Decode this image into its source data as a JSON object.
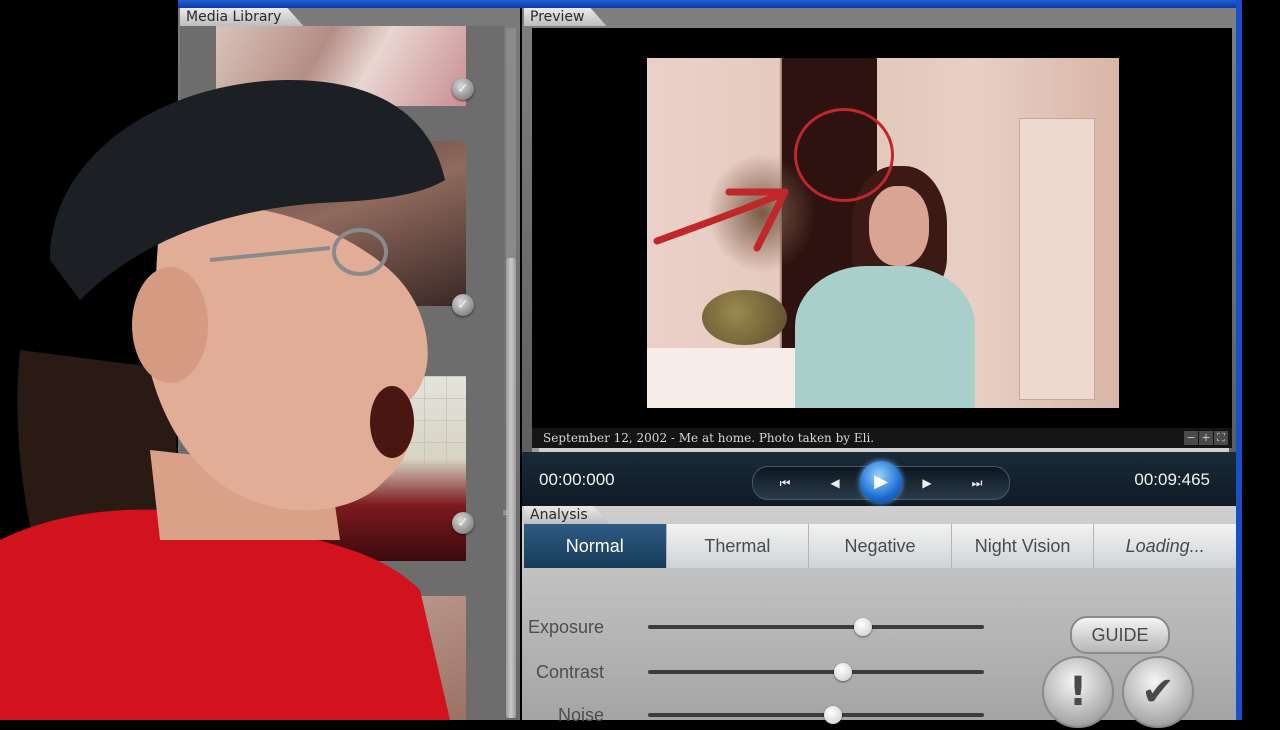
{
  "media_library": {
    "title": "Media Library",
    "thumbnails": [
      {
        "checked": true
      },
      {
        "checked": true
      },
      {
        "checked": true
      },
      {
        "checked": false
      }
    ]
  },
  "preview": {
    "title": "Preview",
    "caption": "September 12, 2002 - Me at home. Photo taken by Eli.",
    "zoom_controls": [
      "−",
      "+",
      "⛶"
    ],
    "time_current": "00:00:000",
    "time_total": "00:09:465",
    "progress_fraction": 0.01,
    "transport": {
      "skip_back": "⏮",
      "step_back": "◀",
      "play": "▶",
      "step_forward": "▶",
      "skip_forward": "⏭"
    }
  },
  "analysis": {
    "title": "Analysis",
    "modes": [
      {
        "label": "Normal",
        "active": true
      },
      {
        "label": "Thermal",
        "active": false
      },
      {
        "label": "Negative",
        "active": false
      },
      {
        "label": "Night Vision",
        "active": false
      },
      {
        "label": "Loading...",
        "active": false
      }
    ],
    "sliders": [
      {
        "label": "Exposure",
        "value": 0.64
      },
      {
        "label": "Contrast",
        "value": 0.58
      },
      {
        "label": "Noise",
        "value": 0.55
      }
    ],
    "guide_label": "GUIDE",
    "alert_label": "!",
    "confirm_label": "✔"
  },
  "colors": {
    "window_frame": "#1a4fc7",
    "active_mode": "#234b6f",
    "annotation_red": "#c0262a"
  }
}
